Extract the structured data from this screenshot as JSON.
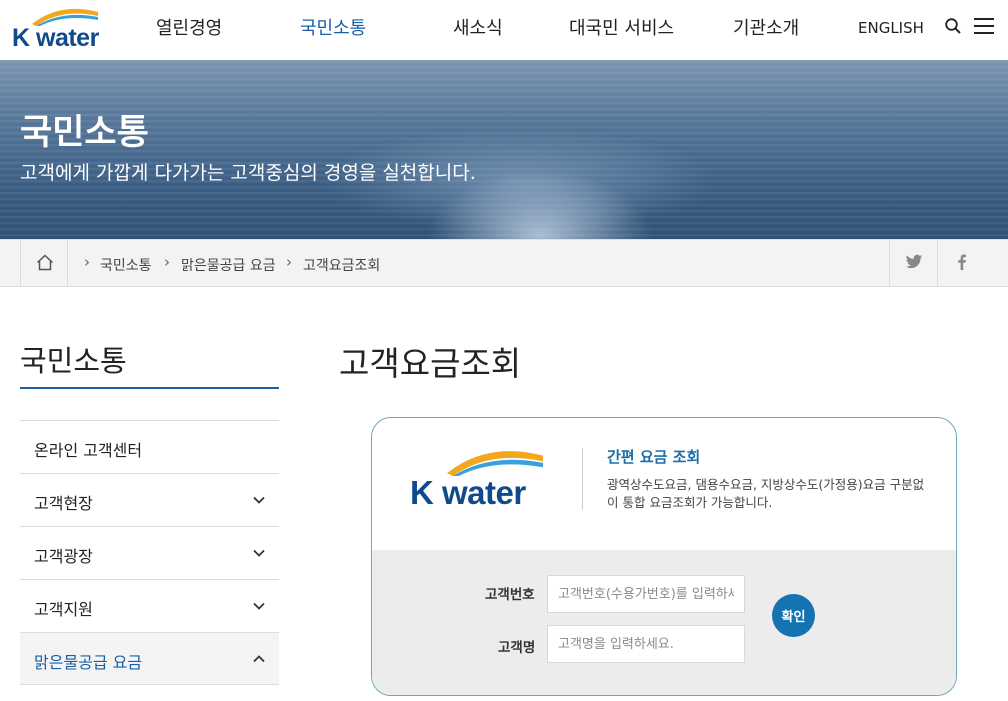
{
  "header": {
    "logo_text": "K water",
    "nav": [
      "열린경영",
      "국민소통",
      "새소식",
      "대국민 서비스",
      "기관소개"
    ],
    "active_nav": "국민소통",
    "lang_label": "ENGLISH",
    "icons": {
      "search": "search-icon",
      "menu": "hamburger-menu-icon"
    }
  },
  "banner": {
    "title": "국민소통",
    "subtitle": "고객에게 가깝게 다가가는 고객중심의 경영을 실천합니다."
  },
  "breadcrumb": {
    "items": [
      "국민소통",
      "맑은물공급 요금",
      "고객요금조회"
    ],
    "share": [
      "twitter-icon",
      "facebook-icon"
    ]
  },
  "sidebar": {
    "title": "국민소통",
    "items": [
      {
        "label": "온라인 고객센터",
        "chevron": "none"
      },
      {
        "label": "고객현장",
        "chevron": "down"
      },
      {
        "label": "고객광장",
        "chevron": "down"
      },
      {
        "label": "고객지원",
        "chevron": "down"
      },
      {
        "label": "맑은물공급 요금",
        "chevron": "up",
        "active": true
      }
    ]
  },
  "main": {
    "title": "고객요금조회",
    "card": {
      "logo_text": "K water",
      "heading": "간편 요금 조회",
      "description": "광역상수도요금, 댐용수요금, 지방상수도(가정용)요금 구분없이 통합 요금조회가 가능합니다.",
      "form": {
        "customer_number_label": "고객번호",
        "customer_number_placeholder": "고객번호(수용가번호)를 입력하세요.",
        "customer_name_label": "고객명",
        "customer_name_placeholder": "고객명을 입력하세요.",
        "submit_label": "확인"
      }
    }
  },
  "colors": {
    "brand_blue": "#1a5ea8",
    "logo_navy": "#0f4a8c",
    "button_blue": "#1673b1",
    "card_border": "#6aa7c5"
  }
}
